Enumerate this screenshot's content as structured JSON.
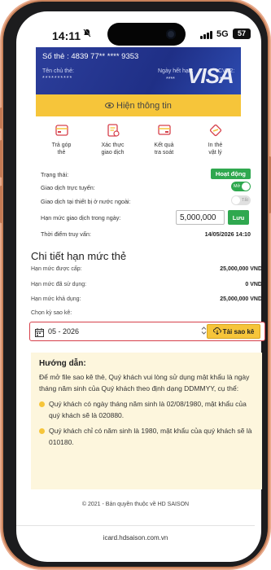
{
  "status_bar": {
    "time": "14:11",
    "network": "5G",
    "battery": "57"
  },
  "card": {
    "number": "Số thẻ : 4839 77** **** 9353",
    "holder_label": "Tên chủ thẻ:",
    "holder_value": "**********",
    "expiry_label": "Ngày hết hạn:",
    "expiry_value": "****",
    "cvv_label": "CVV2:",
    "cvv_value": "***",
    "brand": "VISA"
  },
  "show_info_label": "Hiện thông tin",
  "actions": [
    {
      "icon": "installment-icon",
      "line1": "Trả góp",
      "line2": "thẻ"
    },
    {
      "icon": "verify-transaction-icon",
      "line1": "Xác thực",
      "line2": "giao dịch"
    },
    {
      "icon": "lookup-result-icon",
      "line1": "Kết quả",
      "line2": "tra soát"
    },
    {
      "icon": "print-card-icon",
      "line1": "In thẻ",
      "line2": "vật lý"
    }
  ],
  "settings": {
    "status_label": "Trạng thái:",
    "status_value": "Hoạt động",
    "online_label": "Giao dịch trực tuyến:",
    "online_toggle": "Mở",
    "foreign_label": "Giao dịch tại thiết bị ở nước ngoài:",
    "foreign_toggle": "Tắt",
    "limit_label": "Hạn mức giao dịch trong ngày:",
    "limit_value": "5,000,000",
    "save_label": "Lưu",
    "query_time_label": "Thời điểm truy vấn:",
    "query_time_value": "14/05/2026 14:10"
  },
  "limits": {
    "title": "Chi tiết hạn mức thẻ",
    "granted_label": "Hạn mức được cấp:",
    "granted_value": "25,000,000 VND",
    "used_label": "Hạn mức đã sử dụng:",
    "used_value": "0 VND",
    "available_label": "Hạn mức khả dụng:",
    "available_value": "25,000,000 VND"
  },
  "statement": {
    "period_label": "Chọn kỳ sao kê:",
    "period_value": "05 - 2026",
    "download_label": "Tải sao kê"
  },
  "guide": {
    "title": "Hướng dẫn:",
    "text": "Để mở file sao kê thẻ, Quý khách vui lòng sử dụng mật khẩu là ngày tháng năm sinh của Quý khách theo định dạng DDMMYY, cụ thể:",
    "bullet1": "Quý khách có ngày tháng năm sinh là 02/08/1980, mật khẩu của quý khách sẽ là 020880.",
    "bullet2": "Quý khách chỉ có năm sinh là 1980, mật khẩu của quý khách sẽ là 010180."
  },
  "footer": {
    "copyright": "© 2021 - Bản quyền thuộc về HD SAISON",
    "url": "icard.hdsaison.com.vn"
  },
  "colors": {
    "accent_yellow": "#f6c53a",
    "success_green": "#2fa84f",
    "highlight_red": "#d6404b",
    "card_blue": "#1f2f86"
  }
}
